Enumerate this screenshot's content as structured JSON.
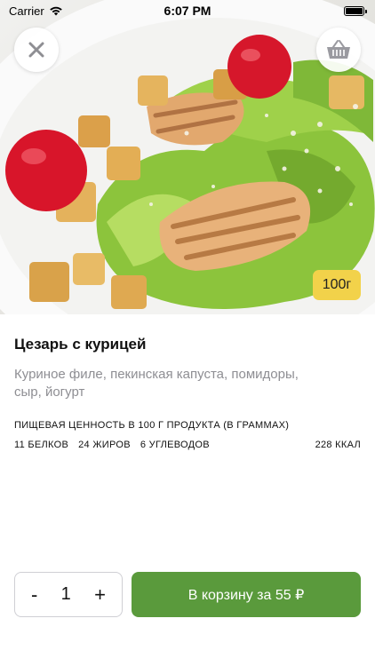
{
  "status_bar": {
    "carrier": "Carrier",
    "time": "6:07 PM"
  },
  "hero": {
    "weight": "100г",
    "icons": {
      "close": "close-icon",
      "cart": "basket-icon"
    }
  },
  "product": {
    "title": "Цезарь с курицей",
    "description": "Куриное филе, пекинская капуста, помидоры, сыр, йогурт"
  },
  "nutrition": {
    "heading": "ПИЩЕВАЯ ЦЕННОСТЬ В 100 Г ПРОДУКТА (В ГРАММАХ)",
    "protein": "11 БЕЛКОВ",
    "fat": "24 ЖИРОВ",
    "carbs": "6 УГЛЕВОДОВ",
    "kcal": "228 ККАЛ"
  },
  "order": {
    "minus": "-",
    "quantity": "1",
    "plus": "+",
    "add_button": "В корзину за 55 ₽"
  },
  "colors": {
    "accent_green": "#5a9a3c",
    "badge_yellow": "#f2d24a",
    "secondary_text": "#8e8e93"
  }
}
